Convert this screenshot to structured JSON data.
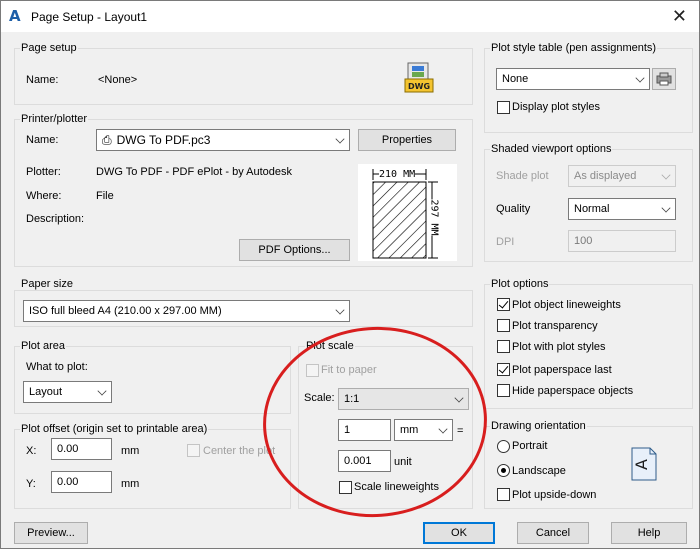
{
  "window": {
    "title": "Page Setup - Layout1",
    "app_icon": "A",
    "close_icon": "✕"
  },
  "page_setup": {
    "group_label": "Page setup",
    "name_label": "Name:",
    "name_value": "<None>",
    "dwg_badge": "DWG"
  },
  "printer": {
    "group_label": "Printer/plotter",
    "name_label": "Name:",
    "name_value": "DWG To PDF.pc3",
    "properties_button": "Properties",
    "plotter_label": "Plotter:",
    "plotter_value": "DWG To PDF - PDF ePlot - by Autodesk",
    "where_label": "Where:",
    "where_value": "File",
    "description_label": "Description:",
    "pdf_options_button": "PDF Options...",
    "preview_width": "210 MM",
    "preview_height": "297 MM"
  },
  "paper_size": {
    "group_label": "Paper size",
    "value": "ISO full bleed A4 (210.00 x 297.00 MM)"
  },
  "plot_area": {
    "group_label": "Plot area",
    "what_label": "What to plot:",
    "value": "Layout"
  },
  "plot_offset": {
    "group_label": "Plot offset (origin set to printable area)",
    "x_label": "X:",
    "x_value": "0.00",
    "x_unit": "mm",
    "y_label": "Y:",
    "y_value": "0.00",
    "y_unit": "mm",
    "center_label": "Center the plot"
  },
  "plot_scale": {
    "group_label": "Plot scale",
    "fit_label": "Fit to paper",
    "scale_label": "Scale:",
    "scale_value": "1:1",
    "top_value": "1",
    "top_unit": "mm",
    "equals": "=",
    "bottom_value": "0.001",
    "bottom_unit": "unit",
    "lineweights_label": "Scale lineweights"
  },
  "plot_style": {
    "group_label": "Plot style table (pen assignments)",
    "value": "None",
    "display_label": "Display plot styles"
  },
  "shaded": {
    "group_label": "Shaded viewport options",
    "shade_label": "Shade plot",
    "shade_value": "As displayed",
    "quality_label": "Quality",
    "quality_value": "Normal",
    "dpi_label": "DPI",
    "dpi_value": "100"
  },
  "plot_options": {
    "group_label": "Plot options",
    "items": [
      {
        "label": "Plot object lineweights",
        "checked": true
      },
      {
        "label": "Plot transparency",
        "checked": false
      },
      {
        "label": "Plot with plot styles",
        "checked": false
      },
      {
        "label": "Plot paperspace last",
        "checked": true
      },
      {
        "label": "Hide paperspace objects",
        "checked": false
      }
    ]
  },
  "orientation": {
    "group_label": "Drawing orientation",
    "portrait": "Portrait",
    "landscape": "Landscape",
    "selected": "Landscape",
    "upside_down": "Plot upside-down",
    "icon_letter": "A"
  },
  "footer": {
    "preview": "Preview...",
    "ok": "OK",
    "cancel": "Cancel",
    "help": "Help"
  },
  "colors": {
    "annotation_ring": "#d81e1e",
    "default_button_border": "#0078d7"
  }
}
